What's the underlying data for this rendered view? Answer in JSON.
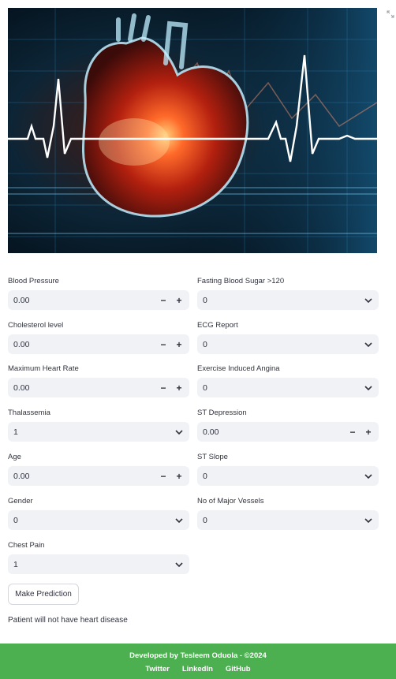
{
  "hero": {
    "alt": "Heart anatomy with ECG waveform illustration"
  },
  "icons": {
    "expand": "expand-icon",
    "minus": "minus-icon",
    "plus": "plus-icon",
    "chevron": "chevron-down-icon"
  },
  "form": {
    "left": [
      {
        "id": "blood-pressure",
        "label": "Blood Pressure",
        "type": "number",
        "value": "0.00"
      },
      {
        "id": "cholesterol-level",
        "label": "Cholesterol level",
        "type": "number",
        "value": "0.00"
      },
      {
        "id": "maximum-heart-rate",
        "label": "Maximum Heart Rate",
        "type": "number",
        "value": "0.00"
      },
      {
        "id": "thalassemia",
        "label": "Thalassemia",
        "type": "select",
        "value": "1"
      },
      {
        "id": "age",
        "label": "Age",
        "type": "number",
        "value": "0.00"
      },
      {
        "id": "gender",
        "label": "Gender",
        "type": "select",
        "value": "0"
      },
      {
        "id": "chest-pain",
        "label": "Chest Pain",
        "type": "select",
        "value": "1"
      }
    ],
    "right": [
      {
        "id": "fasting-blood-sugar",
        "label": "Fasting Blood Sugar >120",
        "type": "select",
        "value": "0"
      },
      {
        "id": "ecg-report",
        "label": "ECG Report",
        "type": "select",
        "value": "0"
      },
      {
        "id": "exercise-induced-angina",
        "label": "Exercise Induced Angina",
        "type": "select",
        "value": "0"
      },
      {
        "id": "st-depression",
        "label": "ST Depression",
        "type": "number",
        "value": "0.00"
      },
      {
        "id": "st-slope",
        "label": "ST Slope",
        "type": "select",
        "value": "0"
      },
      {
        "id": "no-of-major-vessels",
        "label": "No of Major Vessels",
        "type": "select",
        "value": "0"
      }
    ],
    "stepper": {
      "minus": "−",
      "plus": "+"
    }
  },
  "actions": {
    "predict_label": "Make Prediction"
  },
  "result": {
    "text": "Patient will not have heart disease"
  },
  "footer": {
    "credit": "Developed by Tesleem Oduola - ©2024",
    "links": [
      "Twitter",
      "LinkedIn",
      "GitHub"
    ],
    "background": "#4caf50"
  }
}
